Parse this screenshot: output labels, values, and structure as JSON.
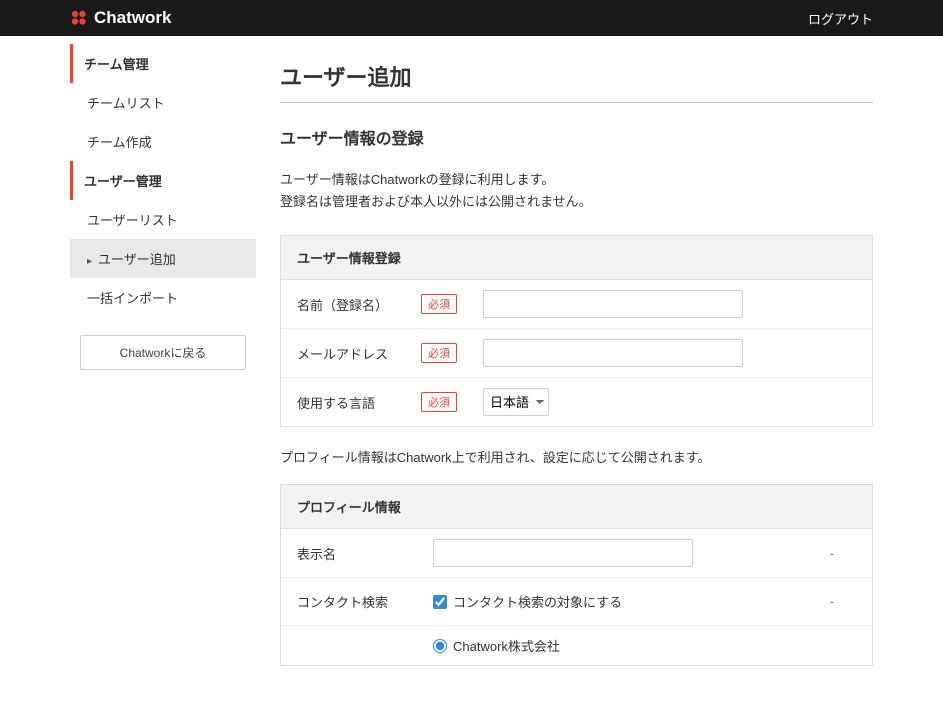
{
  "header": {
    "brand": "Chatwork",
    "logout": "ログアウト"
  },
  "sidebar": {
    "section1": "チーム管理",
    "item_team_list": "チームリスト",
    "item_team_create": "チーム作成",
    "section2": "ユーザー管理",
    "item_user_list": "ユーザーリスト",
    "item_user_add": "ユーザー追加",
    "item_bulk_import": "一括インポート",
    "back_btn": "Chatworkに戻る"
  },
  "main": {
    "title": "ユーザー追加",
    "subtitle": "ユーザー情報の登録",
    "desc_line1": "ユーザー情報はChatworkの登録に利用します。",
    "desc_line2": "登録名は管理者および本人以外には公開されません。",
    "card1_head": "ユーザー情報登録",
    "row_name_label": "名前（登録名）",
    "row_email_label": "メールアドレス",
    "row_lang_label": "使用する言語",
    "required": "必須",
    "lang_value": "日本語",
    "profile_note": "プロフィール情報はChatwork上で利用され、設定に応じて公開されます。",
    "card2_head": "プロフィール情報",
    "row_display_label": "表示名",
    "row_contact_label": "コンタクト検索",
    "contact_checkbox_label": "コンタクト検索の対象にする",
    "org_radio_label": "Chatwork株式会社",
    "dash": "-"
  }
}
